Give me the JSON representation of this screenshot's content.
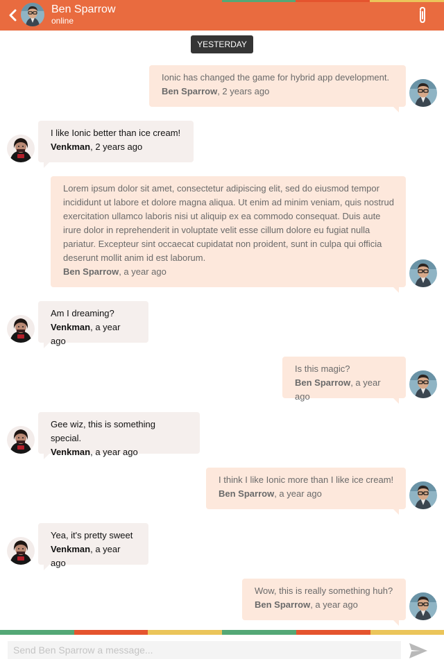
{
  "header": {
    "name": "Ben Sparrow",
    "status": "online",
    "back_icon": "chevron-left-icon",
    "attach_icon": "paperclip-icon",
    "color": "#e96b3f"
  },
  "day_label": "YESTERDAY",
  "messages": [
    {
      "from": "me",
      "text": "Ionic has changed the game for hybrid app development.",
      "author": "Ben Sparrow",
      "time": ", 2 years ago"
    },
    {
      "from": "them",
      "text": "I like Ionic better than ice cream!",
      "author": "Venkman",
      "time": ", 2 years ago"
    },
    {
      "from": "me",
      "text": "Lorem ipsum dolor sit amet, consectetur adipiscing elit, sed do eiusmod tempor incididunt ut labore et dolore magna aliqua. Ut enim ad minim veniam, quis nostrud exercitation ullamco laboris nisi ut aliquip ex ea commodo consequat. Duis aute irure dolor in reprehenderit in voluptate velit esse cillum dolore eu fugiat nulla pariatur. Excepteur sint occaecat cupidatat non proident, sunt in culpa qui officia deserunt mollit anim id est laborum.",
      "author": "Ben Sparrow",
      "time": ", a year ago"
    },
    {
      "from": "them",
      "text": "Am I dreaming?",
      "author": "Venkman",
      "time": ", a year ago"
    },
    {
      "from": "me",
      "text": "Is this magic?",
      "author": "Ben Sparrow",
      "time": ", a year ago"
    },
    {
      "from": "them",
      "text": "Gee wiz, this is something special.",
      "author": "Venkman",
      "time": ", a year ago"
    },
    {
      "from": "me",
      "text": "I think I like Ionic more than I like ice cream!",
      "author": "Ben Sparrow",
      "time": ", a year ago"
    },
    {
      "from": "them",
      "text": "Yea, it's pretty sweet",
      "author": "Venkman",
      "time": ", a year ago"
    },
    {
      "from": "me",
      "text": "Wow, this is really something huh?",
      "author": "Ben Sparrow",
      "time": ", a year ago"
    }
  ],
  "composer": {
    "placeholder": "Send Ben Sparrow a message...",
    "value": "",
    "send_icon": "send-icon"
  },
  "colors": {
    "my_bubble": "#fde8dc",
    "their_bubble": "#f5efed",
    "stripe": [
      "#54a876",
      "#e5542e",
      "#ebc55a"
    ]
  }
}
